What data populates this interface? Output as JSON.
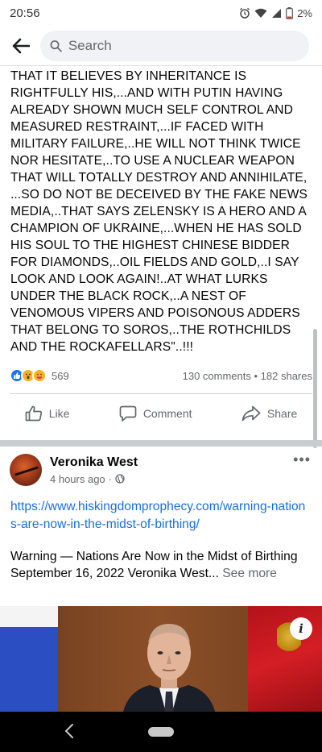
{
  "status_bar": {
    "time": "20:56",
    "battery": "2%",
    "icons": [
      "alarm-icon",
      "wifi-icon",
      "signal-icon",
      "battery-icon"
    ]
  },
  "search": {
    "placeholder": "Search"
  },
  "post1": {
    "text": "THAT IT BELIEVES BY INHERITANCE IS RIGHTFULLY HIS,...AND WITH PUTIN HAVING ALREADY SHOWN MUCH SELF CONTROL AND MEASURED RESTRAINT,...IF FACED WITH MILITARY FAILURE,..HE WILL NOT THINK TWICE NOR HESITATE,..TO USE A NUCLEAR WEAPON THAT WILL TOTALLY DESTROY AND ANNIHILATE, ...SO DO NOT BE DECEIVED BY THE FAKE NEWS MEDIA,..THAT SAYS ZELENSKY IS A HERO AND A CHAMPION OF UKRAINE,...WHEN HE HAS SOLD HIS SOUL TO THE HIGHEST CHINESE BIDDER FOR DIAMONDS,..OIL FIELDS AND GOLD,..I SAY LOOK AND LOOK AGAIN!..AT WHAT LURKS UNDER THE BLACK ROCK,..A NEST OF VENOMOUS VIPERS AND POISONOUS ADDERS THAT BELONG TO SOROS,..THE ROTHCHILDS AND THE ROCKAFELLARS\"..!!!",
    "reaction_count": "569",
    "reactions": [
      "like",
      "wow",
      "care"
    ],
    "comments": "130 comments",
    "shares": "182 shares",
    "like_label": "Like",
    "comment_label": "Comment",
    "share_label": "Share"
  },
  "post2": {
    "author": "Veronika West",
    "time": "4 hours ago",
    "audience_icon": "globe-icon",
    "link": "https://www.hiskingdomprophecy.com/warning-nations-are-now-in-the-midst-of-birthing/",
    "preview_title": "Warning — Nations Are Now in the Midst of Birthing",
    "preview_line": "September 16, 2022 Veronika West...",
    "see_more": "See more",
    "image_info": "i"
  },
  "colors": {
    "link": "#1a6ed8",
    "like_blue": "#1877f2",
    "muted": "#65676b"
  }
}
